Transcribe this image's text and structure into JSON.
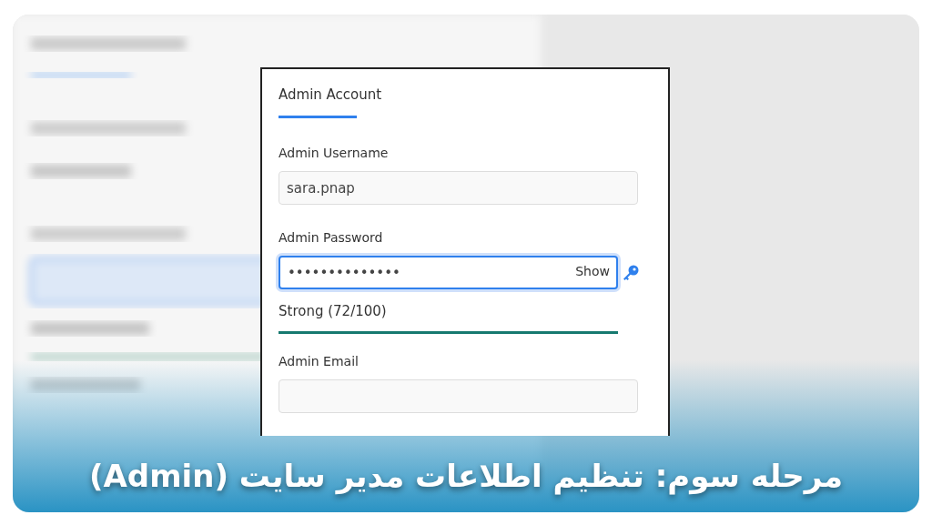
{
  "panel": {
    "title": "Admin Account",
    "fields": [
      {
        "kind": "text",
        "label": "Admin Username",
        "value": "sara.pnap",
        "focused": false
      },
      {
        "kind": "password",
        "label": "Admin Password",
        "value": "••••••••••••••",
        "focused": true,
        "toggle": "Show",
        "strength": {
          "text": "Strong (72/100)",
          "level": 1
        }
      },
      {
        "kind": "text",
        "label": "Admin Email",
        "focused": false
      }
    ]
  },
  "caption": "مرحله سوم: تنظیم اطلاعات مدیر سایت (Admin)"
}
